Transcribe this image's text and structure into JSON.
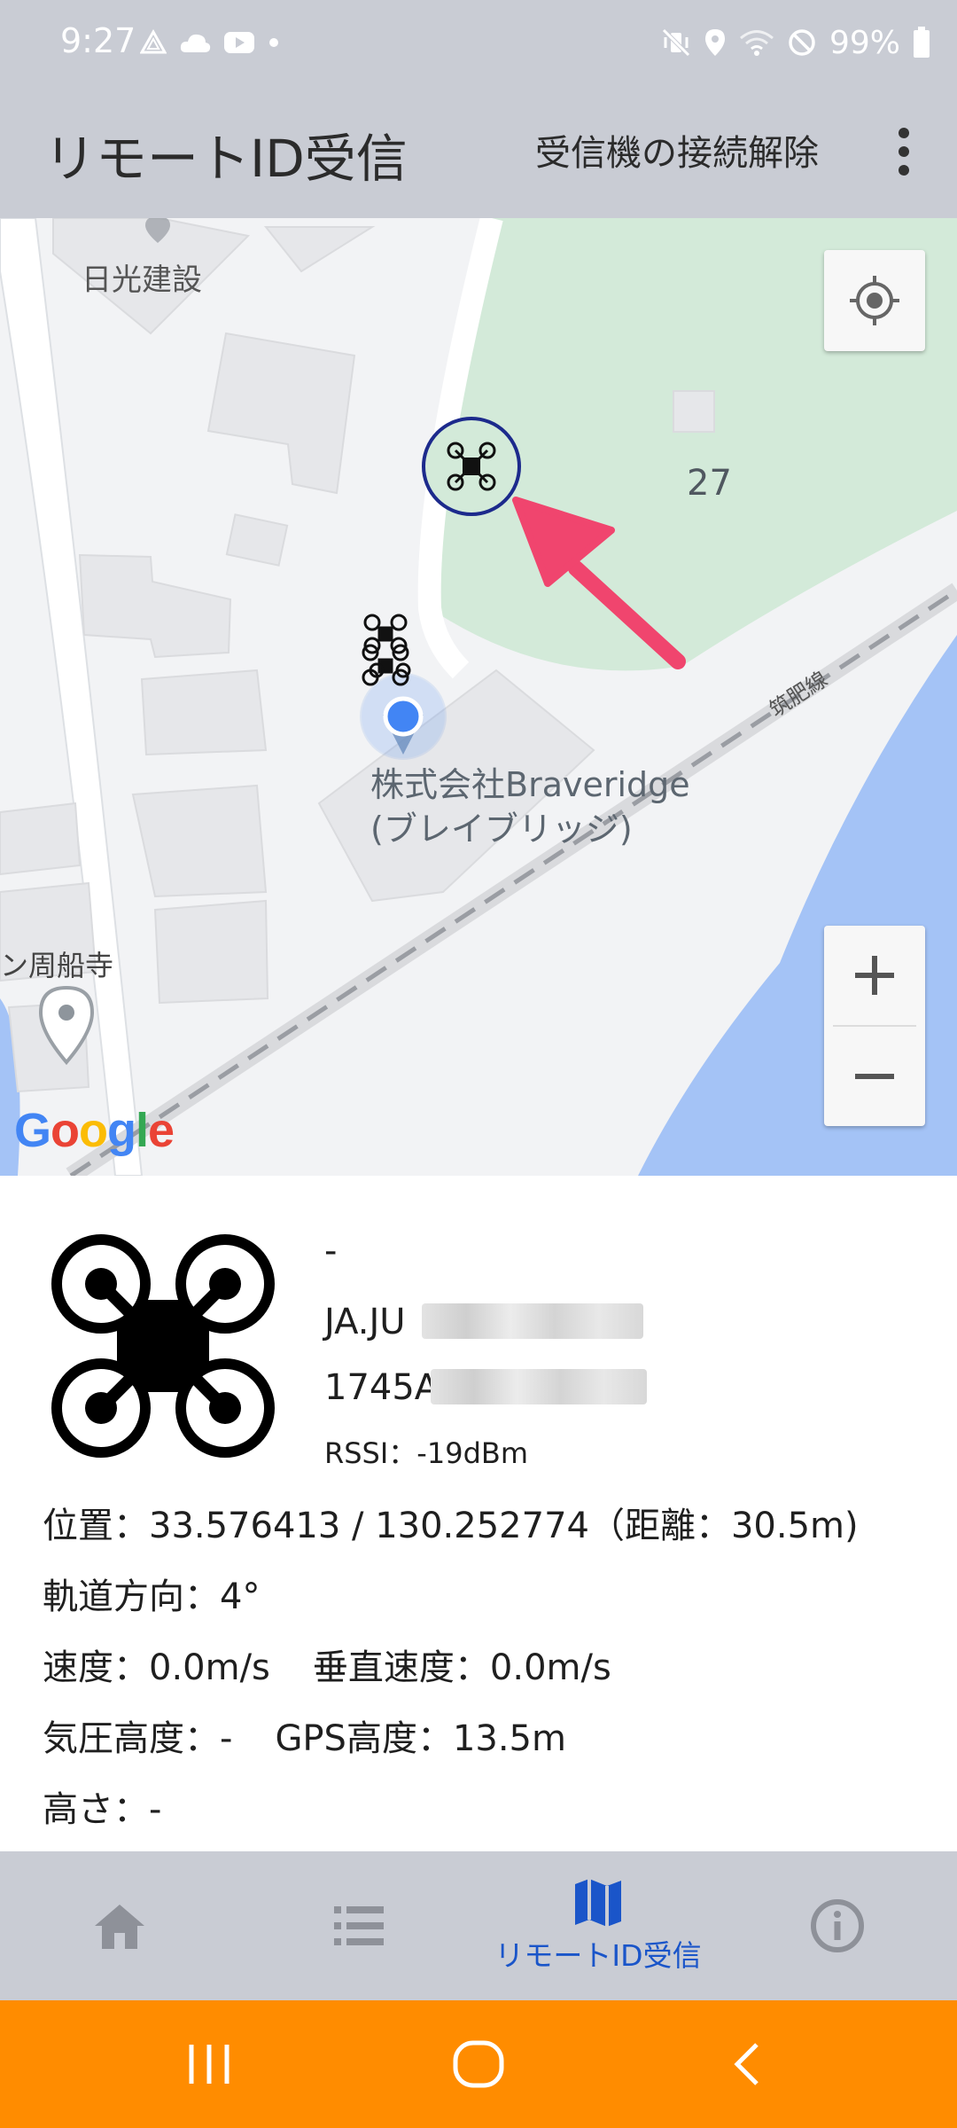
{
  "status_bar": {
    "time": "9:27",
    "battery": "99%",
    "icons": [
      "triangle-warning-icon",
      "cloud-icon",
      "youtube-icon",
      "dot-icon",
      "mute-vibrate-icon",
      "location-pin-icon",
      "wifi-icon",
      "do-not-disturb-icon",
      "battery-icon"
    ]
  },
  "app_bar": {
    "title": "リモートID受信",
    "disconnect_label": "受信機の接続解除",
    "overflow_icon": "more-vert-icon"
  },
  "map": {
    "labels": {
      "company_top": "日光建設",
      "block_number": "27",
      "railway": "筑肥線",
      "temple": "ン周船寺",
      "poi_line1": "株式会社Braveridge",
      "poi_line2": "(ブレイブリッジ)"
    },
    "google_logo": [
      "G",
      "o",
      "o",
      "g",
      "l",
      "e"
    ],
    "my_location_icon": "my-location-icon",
    "zoom_in_icon": "plus-icon",
    "zoom_out_icon": "minus-icon",
    "colors": {
      "park": "#d3ead9",
      "water": "#a4c3f6",
      "highlight_ring": "#1c2a8c",
      "arrow": "#f0456e",
      "user_dot": "#4285f4"
    }
  },
  "drone_info": {
    "name": "-",
    "reg_id_prefix": "JA.JU",
    "serial_prefix": "1745A",
    "rssi": "RSSI：-19dBm",
    "position": "位置：33.576413 / 130.252774（距離：30.5m)",
    "track": "軌道方向：4°",
    "speed": "速度：0.0m/s",
    "vertical_speed": "垂直速度：0.0m/s",
    "pressure_altitude": "気圧高度：-",
    "gps_altitude": "GPS高度：13.5m",
    "height": "高さ：-"
  },
  "bottom_nav": {
    "items": [
      {
        "icon": "home-icon",
        "label": ""
      },
      {
        "icon": "list-icon",
        "label": ""
      },
      {
        "icon": "map-icon",
        "label": "リモートID受信"
      },
      {
        "icon": "info-icon",
        "label": ""
      }
    ],
    "active_color": "#1a55c9",
    "inactive_color": "#8e9199"
  },
  "system_nav": {
    "buttons": [
      "recent-apps-icon",
      "home-circle-icon",
      "back-icon"
    ],
    "background": "#ff8c00"
  }
}
